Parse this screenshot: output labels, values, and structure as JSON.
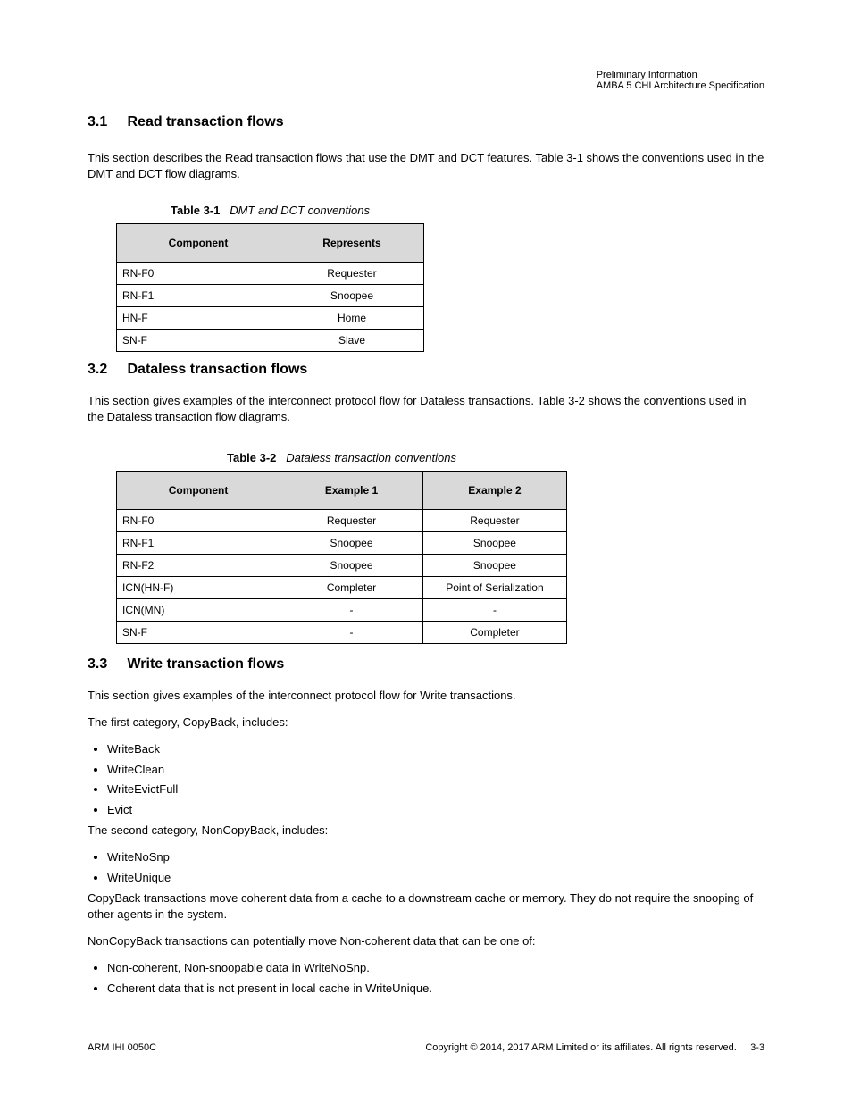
{
  "header": {
    "line1": "Preliminary Information",
    "line2": "AMBA 5 CHI Architecture Specification"
  },
  "section_3_1": {
    "number": "3.1",
    "title": "Read transaction flows",
    "intro": "This section describes the Read transaction flows that use the DMT and DCT features. Table 3-1 shows the conventions used in the DMT and DCT flow diagrams.",
    "table": {
      "label": "Table 3-1",
      "title": "DMT and DCT conventions",
      "headers": [
        "Component",
        "Represents"
      ],
      "rows": [
        [
          "RN-F0",
          "Requester"
        ],
        [
          "RN-F1",
          "Snoopee"
        ],
        [
          "HN-F",
          "Home"
        ],
        [
          "SN-F",
          "Slave"
        ]
      ]
    }
  },
  "section_3_2": {
    "number": "3.2",
    "title": "Dataless transaction flows",
    "intro": "This section gives examples of the interconnect protocol flow for Dataless transactions. Table 3-2 shows the conventions used in the Dataless transaction flow diagrams.",
    "table": {
      "label": "Table 3-2",
      "title": "Dataless transaction conventions",
      "headers": [
        "Component",
        "Example 1",
        "Example 2"
      ],
      "rows": [
        [
          "RN-F0",
          "Requester",
          "Requester"
        ],
        [
          "RN-F1",
          "Snoopee",
          "Snoopee"
        ],
        [
          "RN-F2",
          "Snoopee",
          "Snoopee"
        ],
        [
          "ICN(HN-F)",
          "Completer",
          "Point of Serialization"
        ],
        [
          "ICN(MN)",
          "-",
          "-"
        ],
        [
          "SN-F",
          "-",
          "Completer"
        ]
      ]
    }
  },
  "section_3_3": {
    "number": "3.3",
    "title": "Write transaction flows",
    "paragraph1": "This section gives examples of the interconnect protocol flow for Write transactions.",
    "paragraph2": "The first category, CopyBack, includes:",
    "list1": [
      "WriteBack",
      "WriteClean",
      "WriteEvictFull",
      "Evict"
    ],
    "paragraph3": "The second category, NonCopyBack, includes:",
    "list2": [
      "WriteNoSnp",
      "WriteUnique"
    ],
    "paragraph4": "CopyBack transactions move coherent data from a cache to a downstream cache or memory. They do not require the snooping of other agents in the system.",
    "paragraph5": "NonCopyBack transactions can potentially move Non-coherent data that can be one of:",
    "list3": [
      "Non-coherent, Non-snoopable data in WriteNoSnp.",
      "Coherent data that is not present in local cache in WriteUnique."
    ]
  },
  "footer": {
    "left": "ARM IHI 0050C",
    "right": "Copyright © 2014, 2017 ARM Limited or its affiliates. All rights reserved.",
    "page": "3-3"
  }
}
